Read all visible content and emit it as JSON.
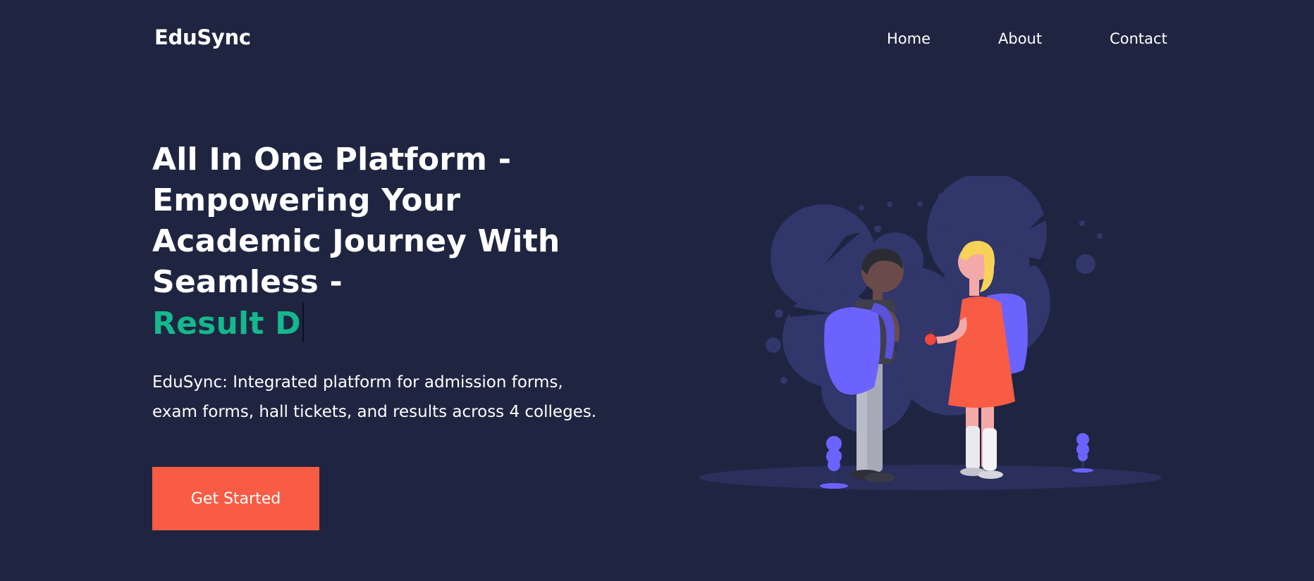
{
  "header": {
    "logo": "EduSync",
    "nav": [
      {
        "label": "Home"
      },
      {
        "label": "About"
      },
      {
        "label": "Contact"
      }
    ]
  },
  "hero": {
    "title_lines": [
      "All In One Platform -",
      "Empowering Your",
      "Academic Journey With",
      "Seamless -"
    ],
    "typed_text": "Result D",
    "description_lines": [
      "EduSync: Integrated platform for admission forms,",
      "exam forms, hall tickets, and results across 4 colleges."
    ],
    "cta_label": "Get Started"
  },
  "colors": {
    "background": "#1f2541",
    "accent_green": "#14b88c",
    "cta": "#f85c45",
    "illustration_purple": "#6c63ff",
    "illustration_shadow": "#2e3466"
  },
  "illustration": {
    "icon": "students-with-backpacks-illustration"
  }
}
